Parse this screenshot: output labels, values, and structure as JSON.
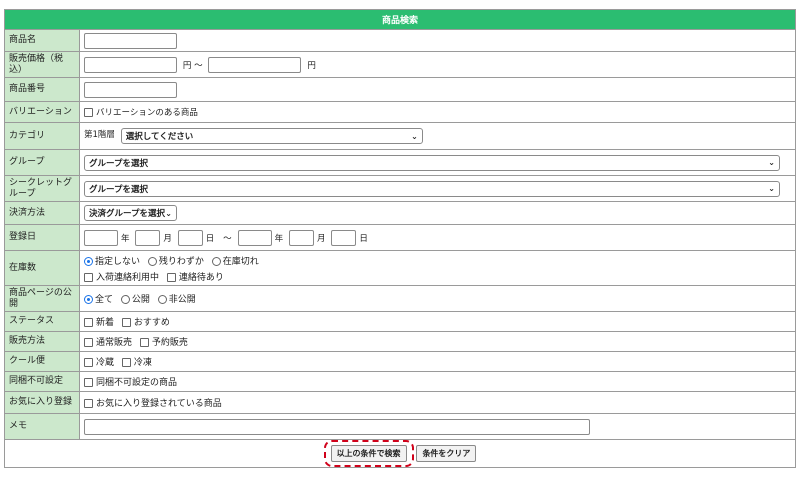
{
  "header": {
    "title": "商品検索"
  },
  "rows": {
    "product_name": {
      "label": "商品名"
    },
    "price": {
      "label": "販売価格（税込）",
      "unit_from": "円 ～",
      "unit_to": "円"
    },
    "product_number": {
      "label": "商品番号"
    },
    "variation": {
      "label": "バリエーション",
      "checkbox_label": "バリエーションのある商品"
    },
    "category": {
      "label": "カテゴリ",
      "level_label": "第1階層",
      "select_value": "選択してください"
    },
    "group": {
      "label": "グループ",
      "select_value": "グループを選択"
    },
    "secret_group": {
      "label": "シークレットグループ",
      "select_value": "グループを選択"
    },
    "payment": {
      "label": "決済方法",
      "select_value": "決済グループを選択"
    },
    "reg_date": {
      "label": "登録日",
      "year": "年",
      "month": "月",
      "day": "日",
      "tilde": "～"
    },
    "stock": {
      "label": "在庫数",
      "radios": [
        "指定しない",
        "残りわずか",
        "在庫切れ"
      ],
      "radio_selected": 0,
      "checkboxes": [
        "入荷連絡利用中",
        "連絡待あり"
      ]
    },
    "publish": {
      "label": "商品ページの公開",
      "radios": [
        "全て",
        "公開",
        "非公開"
      ],
      "radio_selected": 0
    },
    "status": {
      "label": "ステータス",
      "checkboxes": [
        "新着",
        "おすすめ"
      ]
    },
    "sales_method": {
      "label": "販売方法",
      "checkboxes": [
        "通常販売",
        "予約販売"
      ]
    },
    "cool": {
      "label": "クール便",
      "checkboxes": [
        "冷蔵",
        "冷凍"
      ]
    },
    "bundle": {
      "label": "同梱不可設定",
      "checkbox_label": "同梱不可設定の商品"
    },
    "favorite": {
      "label": "お気に入り登録",
      "checkbox_label": "お気に入り登録されている商品"
    },
    "memo": {
      "label": "メモ"
    }
  },
  "buttons": {
    "search": "以上の条件で検索",
    "clear": "条件をクリア"
  },
  "colors": {
    "header": "#2bbd71",
    "label_bg": "#cce8cc",
    "highlight": "#d0021b"
  }
}
